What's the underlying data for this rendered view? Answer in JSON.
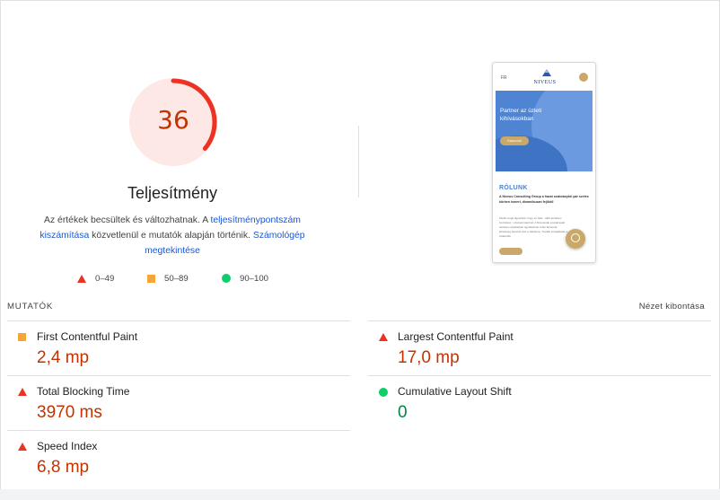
{
  "colors": {
    "fail": "#eb3223",
    "fail_text": "#c33300",
    "average": "#f5a637",
    "pass": "#0cce6b",
    "pass_text": "#018642",
    "link": "#1a57d6"
  },
  "gauge": {
    "score": "36",
    "score_value": 36,
    "category": "Teljesítmény"
  },
  "description": {
    "text_before": "Az értékek becsültek és változhatnak. A ",
    "link1": "teljesítménypontszám kiszámítása",
    "text_middle": " közvetlenül e mutatók alapján történik. ",
    "link2": "Számológép megtekintése"
  },
  "legend": [
    {
      "icon": "fail-triangle-icon",
      "label": "0–49"
    },
    {
      "icon": "average-square-icon",
      "label": "50–89"
    },
    {
      "icon": "pass-circle-icon",
      "label": "90–100"
    }
  ],
  "screenshot": {
    "lang": "FR",
    "logo": "NIVEUS",
    "hero_text": "Partner az üzleti kihívásokban",
    "hero_button": "Kapcsolat",
    "section_title": "RÓLUNK",
    "section_sub": "A Niveus Consulting Group a hazai szabványtól pár széles körben ismert, dinamikusan fejlődő",
    "section_body": "Ábrák mögé figyeltünk: hogy ez ötlet - több területen hozzátesz - számok hasznát. A Niveusnak a tanácsadó területen elvárásban ügyfeleknek szóló felmenőt, lehetőség fokozott lesz a hatékony. Tovább szolgáltatás a szakértők."
  },
  "metrics_header": {
    "label": "MUTATÓK",
    "expand": "Nézet kibontása"
  },
  "metrics": [
    {
      "title": "First Contentful Paint",
      "value": "2,4 mp",
      "rating": "average"
    },
    {
      "title": "Largest Contentful Paint",
      "value": "17,0 mp",
      "rating": "fail"
    },
    {
      "title": "Total Blocking Time",
      "value": "3970 ms",
      "rating": "fail"
    },
    {
      "title": "Cumulative Layout Shift",
      "value": "0",
      "rating": "pass"
    },
    {
      "title": "Speed Index",
      "value": "6,8 mp",
      "rating": "fail"
    }
  ]
}
